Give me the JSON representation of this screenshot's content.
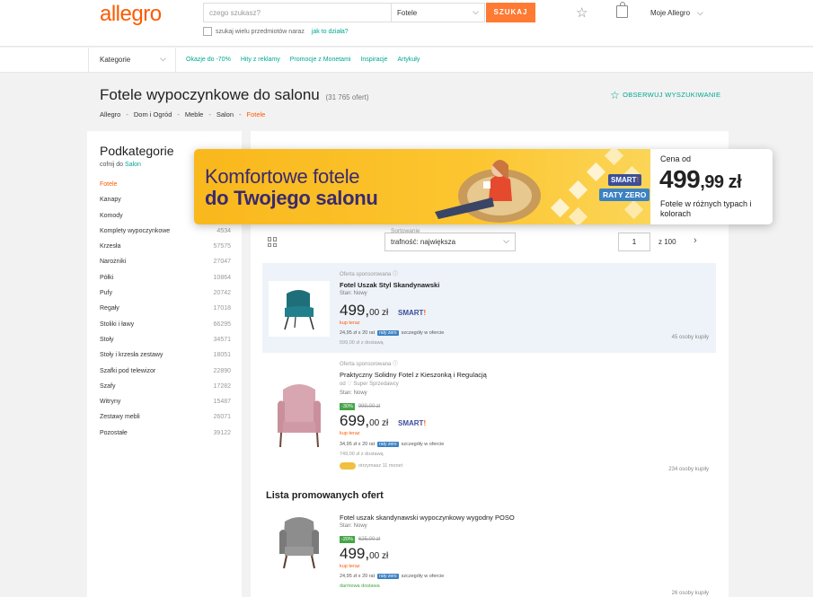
{
  "header": {
    "logo": "allegro",
    "search_placeholder": "czego szukasz?",
    "category": "Fotele",
    "search_button": "SZUKAJ",
    "multi_search": "szukaj wielu przedmiotów naraz",
    "multi_search_link": "jak to działa?",
    "account": "Moje Allegro"
  },
  "nav": {
    "categories": "Kategorie",
    "links": [
      "Okazje do -70%",
      "Hity z reklamy",
      "Promocje z Monetami",
      "Inspiracje",
      "Artykuły"
    ]
  },
  "page": {
    "title": "Fotele wypoczynkowe do salonu",
    "count": "(31 765 ofert)",
    "breadcrumb": [
      "Allegro",
      "Dom i Ogród",
      "Meble",
      "Salon",
      "Fotele"
    ],
    "watch": "OBSERWUJ WYSZUKIWANIE"
  },
  "sidebar": {
    "title": "Podkategorie",
    "back_prefix": "cofnij do",
    "back_link": "Salon",
    "items": [
      {
        "label": "Fotele",
        "count": ""
      },
      {
        "label": "Kanapy",
        "count": ""
      },
      {
        "label": "Komody",
        "count": ""
      },
      {
        "label": "Komplety wypoczynkowe",
        "count": "4534"
      },
      {
        "label": "Krzesła",
        "count": "57575"
      },
      {
        "label": "Narożniki",
        "count": "27047"
      },
      {
        "label": "Półki",
        "count": "10864"
      },
      {
        "label": "Pufy",
        "count": "20742"
      },
      {
        "label": "Regały",
        "count": "17018"
      },
      {
        "label": "Stoliki i ławy",
        "count": "66295"
      },
      {
        "label": "Stoły",
        "count": "34571"
      },
      {
        "label": "Stoły i krzesła zestawy",
        "count": "18051"
      },
      {
        "label": "Szafki pod telewizor",
        "count": "22890"
      },
      {
        "label": "Szafy",
        "count": "17282"
      },
      {
        "label": "Witryny",
        "count": "15487"
      },
      {
        "label": "Zestawy mebli",
        "count": "26071"
      },
      {
        "label": "Pozostałe",
        "count": "39122"
      }
    ]
  },
  "listing": {
    "sort_label": "Sortowanie",
    "sort_value": "trafność: największa",
    "page": "1",
    "page_of": "z   100",
    "promo_title": "Lista promowanych ofert",
    "offers": [
      {
        "meta": "Oferta sponsorowana ⓘ",
        "name": "Fotel Uszak Styl Skandynawski",
        "state": "Stan: Nowy",
        "price_main": "499,",
        "price_dec": "00 zł",
        "smart": "SMART",
        "buy": "kup teraz",
        "installments": "24,95 zł x 20 rat",
        "installments_badge": "raty zero",
        "installments_suffix": "szczegóły w ofercie",
        "shipping": "599,00 zł z dostawą",
        "buyers": "45 osoby kupiły"
      },
      {
        "meta": "Oferta sponsorowana ⓘ",
        "name": "Praktyczny Solidny Fotel z Kieszonką i Regulacją",
        "seller": "od ♡ Super Sprzedawcy",
        "state": "Stan: Nowy",
        "discount": "-30%",
        "old_price": "999,00 zł",
        "price_main": "699,",
        "price_dec": "00 zł",
        "smart": "SMART",
        "buy": "kup teraz",
        "installments": "34,95 zł x 20 rat",
        "installments_badge": "raty zero",
        "installments_suffix": "szczegóły w ofercie",
        "shipping": "749,00 zł z dostawą",
        "coins": "otrzymasz 11 monet",
        "buyers": "234 osoby kupiły"
      },
      {
        "name": "Fotel uszak skandynawski wypoczynkowy wygodny POSO",
        "state": "Stan: Nowy",
        "discount": "-20%",
        "old_price": "625,00 zł",
        "price_main": "499,",
        "price_dec": "00 zł",
        "buy": "kup teraz",
        "installments": "24,95 zł x 20 rat",
        "installments_badge": "raty zero",
        "installments_suffix": "szczegóły w ofercie",
        "free": "darmowa dostawa",
        "buyers": "26 osoby kupiły"
      }
    ]
  },
  "banner": {
    "line1": "Komfortowe fotele",
    "line2": "do Twojego salonu",
    "smart": "SMART",
    "raty": "RATY ZERO",
    "price_label": "Cena od",
    "price_int": "499",
    "price_dec": ",99",
    "price_cur": " zł",
    "desc": "Fotele w różnych typach i kolorach"
  },
  "colors": {
    "brand": "#ff5a00",
    "link": "#00a790",
    "banner_bg": "#f9b81c",
    "banner_text": "#3a2a6e"
  }
}
